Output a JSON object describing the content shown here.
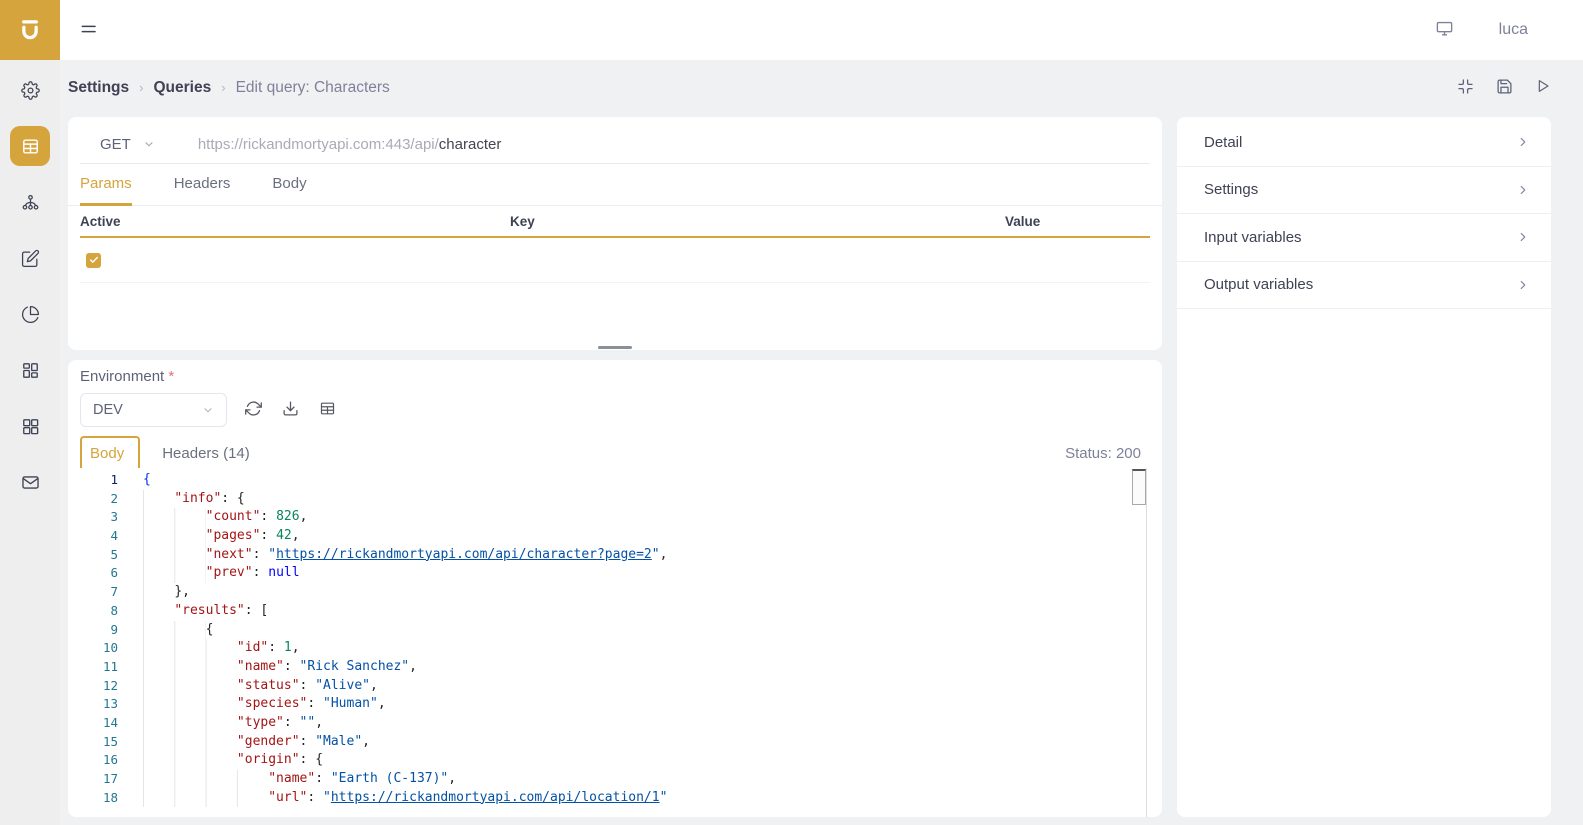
{
  "colors": {
    "accent": "#D5A43C",
    "text_primary": "#3F4254",
    "text_secondary": "#7E8299",
    "json_key": "#A31515",
    "json_string": "#0451A5",
    "json_number": "#098658",
    "json_keyword": "#0000FF",
    "line_number": "#237893"
  },
  "topbar": {
    "user": "luca"
  },
  "sidebar": {
    "items": [
      {
        "icon": "gear-icon",
        "active": false
      },
      {
        "icon": "table-icon",
        "active": true
      },
      {
        "icon": "hierarchy-icon",
        "active": false
      },
      {
        "icon": "edit-icon",
        "active": false
      },
      {
        "icon": "pie-chart-icon",
        "active": false
      },
      {
        "icon": "layout-icon",
        "active": false
      },
      {
        "icon": "grid-icon",
        "active": false
      },
      {
        "icon": "mail-icon",
        "active": false
      }
    ]
  },
  "breadcrumb": {
    "items": [
      {
        "label": "Settings",
        "bold": true,
        "current": false
      },
      {
        "label": "Queries",
        "bold": true,
        "current": false
      },
      {
        "label": "Edit query: Characters",
        "bold": false,
        "current": true
      }
    ],
    "separator": "›",
    "actions": [
      {
        "icon": "compress-icon"
      },
      {
        "icon": "save-icon"
      },
      {
        "icon": "run-icon"
      }
    ]
  },
  "request": {
    "method": "GET",
    "url_prefix": "https://rickandmortyapi.com:443/api/",
    "url_suffix": "character",
    "tabs": [
      {
        "label": "Params",
        "active": true
      },
      {
        "label": "Headers",
        "active": false
      },
      {
        "label": "Body",
        "active": false
      }
    ],
    "table": {
      "columns": [
        "Active",
        "Key",
        "Value"
      ],
      "rows": [
        {
          "active": true,
          "key": "",
          "value": ""
        }
      ]
    }
  },
  "response": {
    "environment_label": "Environment",
    "required_mark": "*",
    "environment_value": "DEV",
    "env_tools": [
      {
        "icon": "refresh-icon"
      },
      {
        "icon": "download-icon"
      },
      {
        "icon": "table-small-icon"
      }
    ],
    "tabs": [
      {
        "label": "Body",
        "active": true
      },
      {
        "label": "Headers (14)",
        "active": false
      }
    ],
    "status_text": "Status: 200"
  },
  "right_panel": {
    "items": [
      {
        "label": "Detail"
      },
      {
        "label": "Settings"
      },
      {
        "label": "Input variables"
      },
      {
        "label": "Output variables"
      }
    ]
  },
  "editor": {
    "lines": [
      {
        "n": 1,
        "tokens": [
          {
            "t": "{",
            "c": "br"
          }
        ]
      },
      {
        "n": 2,
        "tokens": [
          {
            "t": "    ",
            "c": "ws"
          },
          {
            "t": "\"info\"",
            "c": "key"
          },
          {
            "t": ": {",
            "c": "pu"
          }
        ]
      },
      {
        "n": 3,
        "tokens": [
          {
            "t": "        ",
            "c": "ws"
          },
          {
            "t": "\"count\"",
            "c": "key"
          },
          {
            "t": ": ",
            "c": "pu"
          },
          {
            "t": "826",
            "c": "num"
          },
          {
            "t": ",",
            "c": "pu"
          }
        ]
      },
      {
        "n": 4,
        "tokens": [
          {
            "t": "        ",
            "c": "ws"
          },
          {
            "t": "\"pages\"",
            "c": "key"
          },
          {
            "t": ": ",
            "c": "pu"
          },
          {
            "t": "42",
            "c": "num"
          },
          {
            "t": ",",
            "c": "pu"
          }
        ]
      },
      {
        "n": 5,
        "tokens": [
          {
            "t": "        ",
            "c": "ws"
          },
          {
            "t": "\"next\"",
            "c": "key"
          },
          {
            "t": ": ",
            "c": "pu"
          },
          {
            "t": "\"",
            "c": "str"
          },
          {
            "t": "https://rickandmortyapi.com/api/character?page=2",
            "c": "lk"
          },
          {
            "t": "\"",
            "c": "str"
          },
          {
            "t": ",",
            "c": "pu"
          }
        ]
      },
      {
        "n": 6,
        "tokens": [
          {
            "t": "        ",
            "c": "ws"
          },
          {
            "t": "\"prev\"",
            "c": "key"
          },
          {
            "t": ": ",
            "c": "pu"
          },
          {
            "t": "null",
            "c": "kw"
          }
        ]
      },
      {
        "n": 7,
        "tokens": [
          {
            "t": "    ",
            "c": "ws"
          },
          {
            "t": "},",
            "c": "pu"
          }
        ]
      },
      {
        "n": 8,
        "tokens": [
          {
            "t": "    ",
            "c": "ws"
          },
          {
            "t": "\"results\"",
            "c": "key"
          },
          {
            "t": ": [",
            "c": "pu"
          }
        ]
      },
      {
        "n": 9,
        "tokens": [
          {
            "t": "        ",
            "c": "ws"
          },
          {
            "t": "{",
            "c": "pu"
          }
        ]
      },
      {
        "n": 10,
        "tokens": [
          {
            "t": "            ",
            "c": "ws"
          },
          {
            "t": "\"id\"",
            "c": "key"
          },
          {
            "t": ": ",
            "c": "pu"
          },
          {
            "t": "1",
            "c": "num"
          },
          {
            "t": ",",
            "c": "pu"
          }
        ]
      },
      {
        "n": 11,
        "tokens": [
          {
            "t": "            ",
            "c": "ws"
          },
          {
            "t": "\"name\"",
            "c": "key"
          },
          {
            "t": ": ",
            "c": "pu"
          },
          {
            "t": "\"Rick Sanchez\"",
            "c": "str"
          },
          {
            "t": ",",
            "c": "pu"
          }
        ]
      },
      {
        "n": 12,
        "tokens": [
          {
            "t": "            ",
            "c": "ws"
          },
          {
            "t": "\"status\"",
            "c": "key"
          },
          {
            "t": ": ",
            "c": "pu"
          },
          {
            "t": "\"Alive\"",
            "c": "str"
          },
          {
            "t": ",",
            "c": "pu"
          }
        ]
      },
      {
        "n": 13,
        "tokens": [
          {
            "t": "            ",
            "c": "ws"
          },
          {
            "t": "\"species\"",
            "c": "key"
          },
          {
            "t": ": ",
            "c": "pu"
          },
          {
            "t": "\"Human\"",
            "c": "str"
          },
          {
            "t": ",",
            "c": "pu"
          }
        ]
      },
      {
        "n": 14,
        "tokens": [
          {
            "t": "            ",
            "c": "ws"
          },
          {
            "t": "\"type\"",
            "c": "key"
          },
          {
            "t": ": ",
            "c": "pu"
          },
          {
            "t": "\"\"",
            "c": "str"
          },
          {
            "t": ",",
            "c": "pu"
          }
        ]
      },
      {
        "n": 15,
        "tokens": [
          {
            "t": "            ",
            "c": "ws"
          },
          {
            "t": "\"gender\"",
            "c": "key"
          },
          {
            "t": ": ",
            "c": "pu"
          },
          {
            "t": "\"Male\"",
            "c": "str"
          },
          {
            "t": ",",
            "c": "pu"
          }
        ]
      },
      {
        "n": 16,
        "tokens": [
          {
            "t": "            ",
            "c": "ws"
          },
          {
            "t": "\"origin\"",
            "c": "key"
          },
          {
            "t": ": {",
            "c": "pu"
          }
        ]
      },
      {
        "n": 17,
        "tokens": [
          {
            "t": "                ",
            "c": "ws"
          },
          {
            "t": "\"name\"",
            "c": "key"
          },
          {
            "t": ": ",
            "c": "pu"
          },
          {
            "t": "\"Earth (C-137)\"",
            "c": "str"
          },
          {
            "t": ",",
            "c": "pu"
          }
        ]
      },
      {
        "n": 18,
        "tokens": [
          {
            "t": "                ",
            "c": "ws"
          },
          {
            "t": "\"url\"",
            "c": "key"
          },
          {
            "t": ": ",
            "c": "pu"
          },
          {
            "t": "\"",
            "c": "str"
          },
          {
            "t": "https://rickandmortyapi.com/api/location/1",
            "c": "lk"
          },
          {
            "t": "\"",
            "c": "str"
          }
        ]
      }
    ]
  }
}
